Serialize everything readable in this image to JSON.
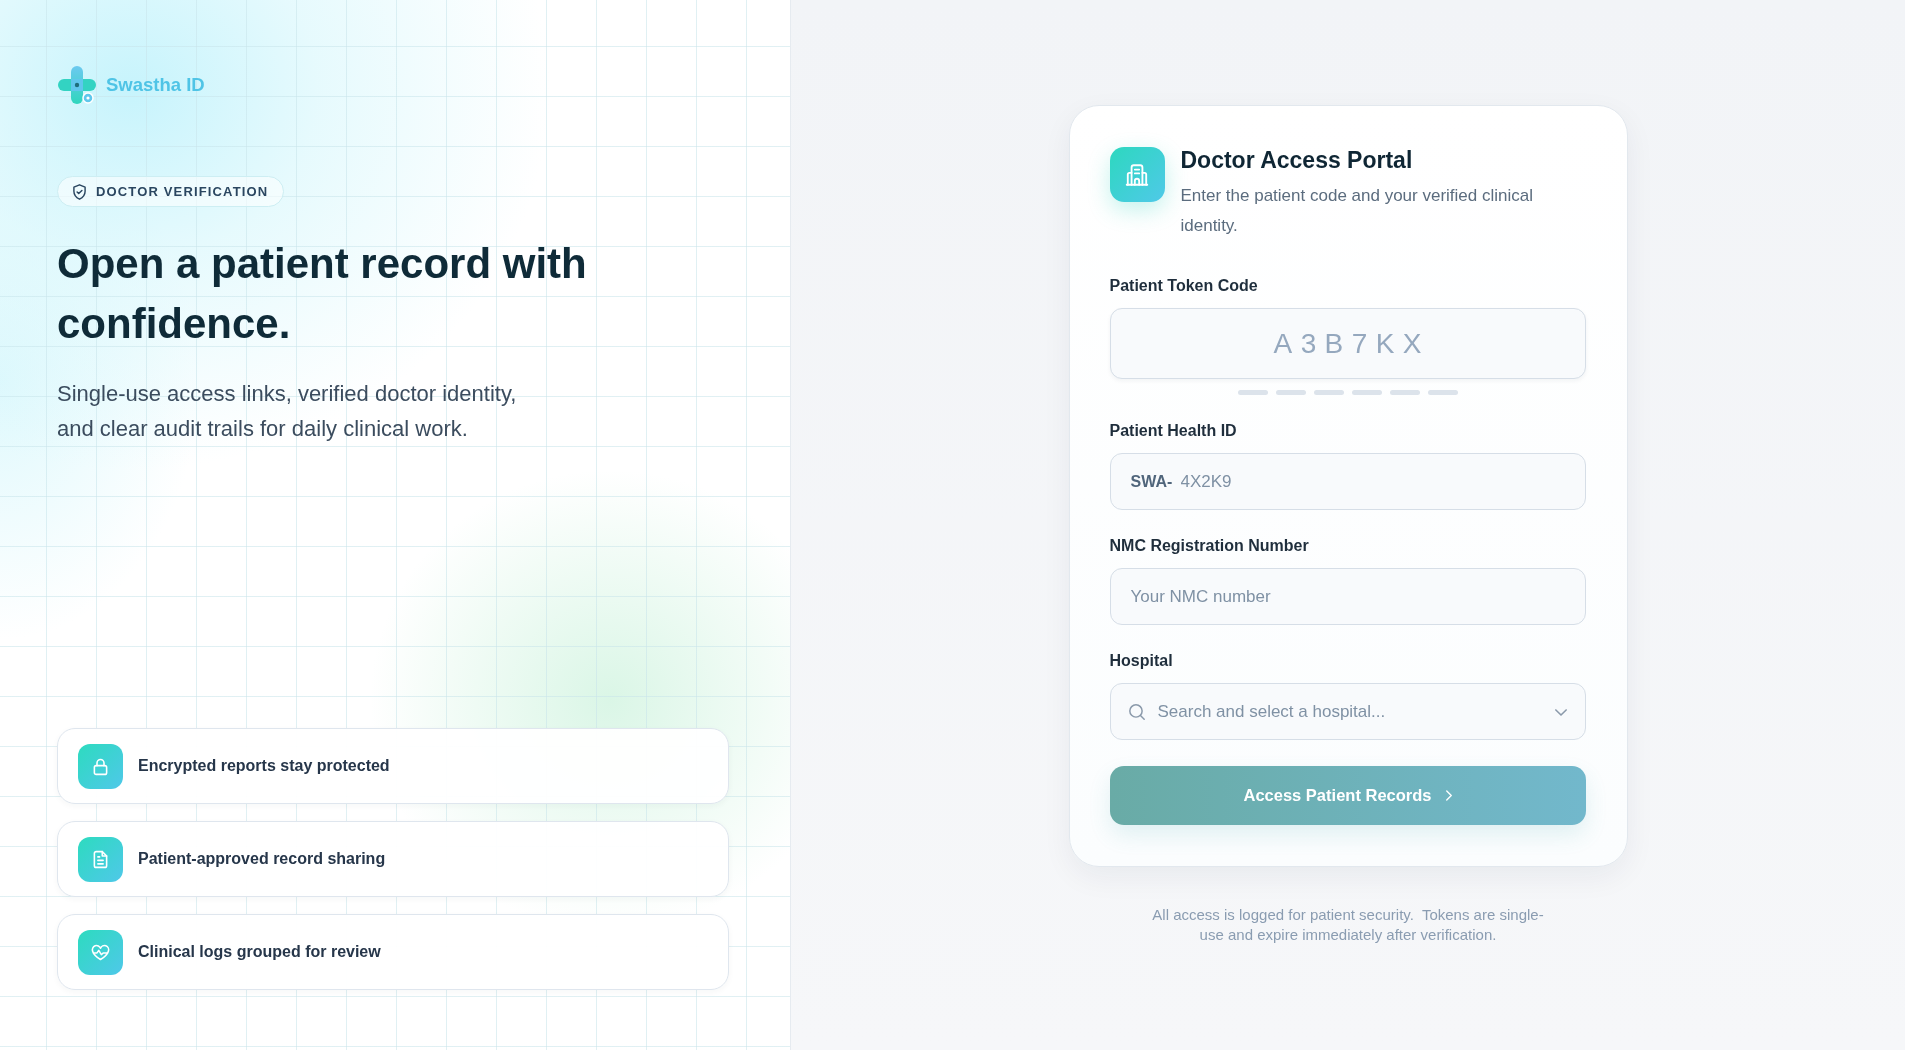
{
  "brand": {
    "name": "Swastha ID"
  },
  "hero": {
    "badge": "DOCTOR VERIFICATION",
    "title": "Open a patient record with confidence.",
    "subtitle": "Single-use access links, verified doctor identity, and clear audit trails for daily clinical work."
  },
  "features": [
    {
      "kind": "encryption",
      "label": "Encrypted reports stay protected"
    },
    {
      "kind": "sharing",
      "label": "Patient-approved record sharing"
    },
    {
      "kind": "audit",
      "label": "Clinical logs grouped for review"
    }
  ],
  "portal": {
    "title": "Doctor Access Portal",
    "subtitle": "Enter the patient code and your verified clinical identity.",
    "fields": [
      {
        "kind": "token",
        "label": "Patient Token Code",
        "placeholder": "A3B7KX"
      },
      {
        "kind": "prefixed",
        "label": "Patient Health ID",
        "prefix": "SWA-",
        "placeholder": "4X2K9"
      },
      {
        "kind": "text",
        "label": "NMC Registration Number",
        "placeholder": "Your NMC number"
      },
      {
        "kind": "search_select",
        "label": "Hospital",
        "placeholder": "Search and select a hospital..."
      }
    ],
    "submit": {
      "label": "Access Patient Records",
      "disabled": true
    }
  },
  "footnote": "All access is logged for patient security.  Tokens are single-use and expire immediately after verification."
}
